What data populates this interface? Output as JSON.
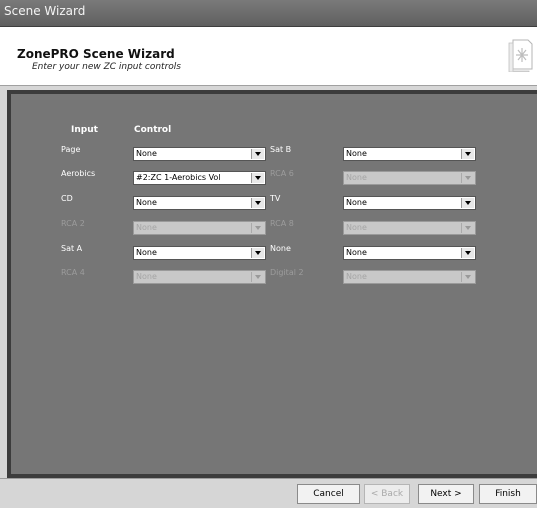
{
  "window": {
    "title": "Scene Wizard"
  },
  "header": {
    "title": "ZonePRO Scene Wizard",
    "subtitle": "Enter your new ZC input controls"
  },
  "columns": {
    "input": "Input",
    "control": "Control"
  },
  "left_rows": [
    {
      "label": "Page",
      "value": "None",
      "enabled": true
    },
    {
      "label": "Aerobics",
      "value": "#2:ZC 1-Aerobics Vol",
      "enabled": true
    },
    {
      "label": "CD",
      "value": "None",
      "enabled": true
    },
    {
      "label": "RCA 2",
      "value": "None",
      "enabled": false
    },
    {
      "label": "Sat A",
      "value": "None",
      "enabled": true
    },
    {
      "label": "RCA 4",
      "value": "None",
      "enabled": false
    }
  ],
  "right_rows": [
    {
      "label": "Sat B",
      "value": "None",
      "enabled": true
    },
    {
      "label": "RCA 6",
      "value": "None",
      "enabled": false
    },
    {
      "label": "TV",
      "value": "None",
      "enabled": true
    },
    {
      "label": "RCA 8",
      "value": "None",
      "enabled": false
    },
    {
      "label": "None",
      "value": "None",
      "enabled": true
    },
    {
      "label": "Digital 2",
      "value": "None",
      "enabled": false
    }
  ],
  "buttons": {
    "cancel": "Cancel",
    "back": "< Back",
    "next": "Next >",
    "finish": "Finish"
  }
}
